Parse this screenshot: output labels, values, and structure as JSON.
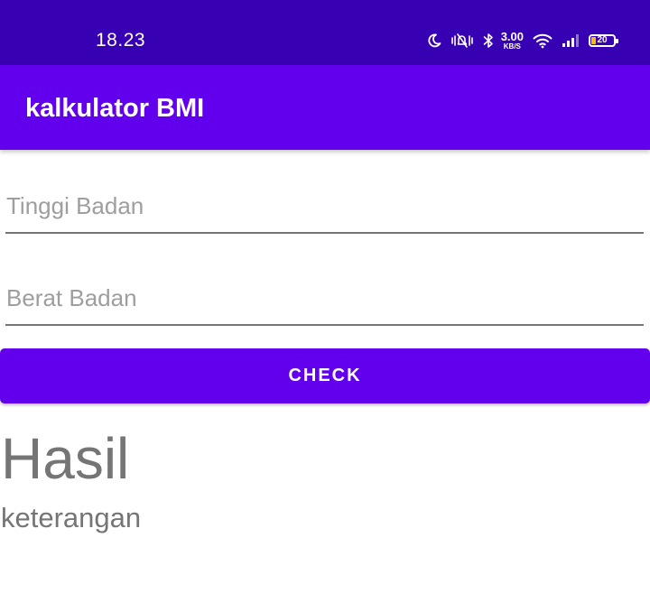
{
  "status_bar": {
    "time": "18.23",
    "net_speed_value": "3.00",
    "net_speed_unit": "KB/S",
    "battery_level": "20",
    "icons": [
      "moon-icon",
      "vibrate-icon",
      "bluetooth-icon",
      "wifi-icon",
      "signal-icon",
      "battery-icon"
    ],
    "background": "#3700b3"
  },
  "app_bar": {
    "title": "kalkulator BMI",
    "background": "#6200ee"
  },
  "form": {
    "height_placeholder": "Tinggi Badan",
    "height_value": "",
    "weight_placeholder": "Berat Badan",
    "weight_value": "",
    "check_label": "CHECK"
  },
  "result": {
    "title": "Hasil",
    "description": "keterangan"
  },
  "colors": {
    "primary": "#6200ee",
    "primary_dark": "#3700b3",
    "text_secondary": "#757575",
    "battery_fill": "#f2c100"
  }
}
